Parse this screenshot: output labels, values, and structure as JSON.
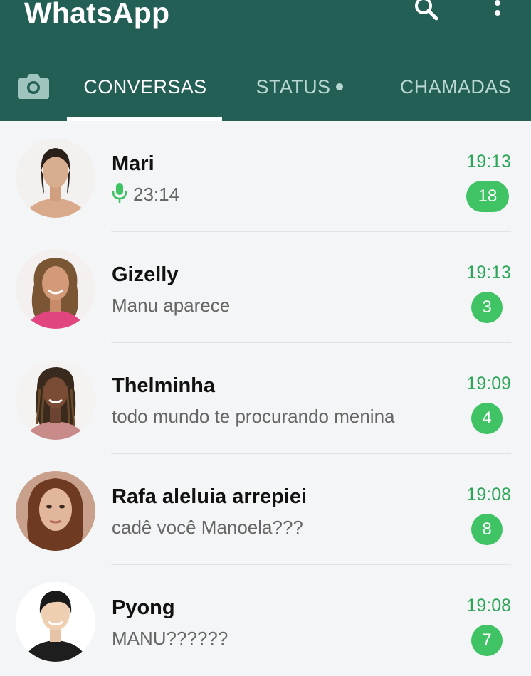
{
  "header": {
    "title": "WhatsApp",
    "search_icon": "search-icon",
    "menu_icon": "more-vert-icon",
    "bg_color": "#245f56"
  },
  "tabs": [
    {
      "label": "CONVERSAS",
      "active": true
    },
    {
      "label": "STATUS",
      "active": false
    },
    {
      "label": "CHAMADAS",
      "active": false
    }
  ],
  "chats": [
    {
      "name": "Mari",
      "preview": "23:14",
      "preview_icon": "mic-icon",
      "time": "19:13",
      "unread": "18"
    },
    {
      "name": "Gizelly",
      "preview": "Manu aparece",
      "time": "19:13",
      "unread": "3"
    },
    {
      "name": "Thelminha",
      "preview": "todo mundo te procurando menina",
      "time": "19:09",
      "unread": "4"
    },
    {
      "name": "Rafa aleluia arrepiei",
      "preview": "cadê você Manoela???",
      "time": "19:08",
      "unread": "8"
    },
    {
      "name": "Pyong",
      "preview": "MANU??????",
      "time": "19:08",
      "unread": "7"
    }
  ],
  "colors": {
    "accent_green": "#3fc365",
    "time_green": "#2ea65a"
  }
}
